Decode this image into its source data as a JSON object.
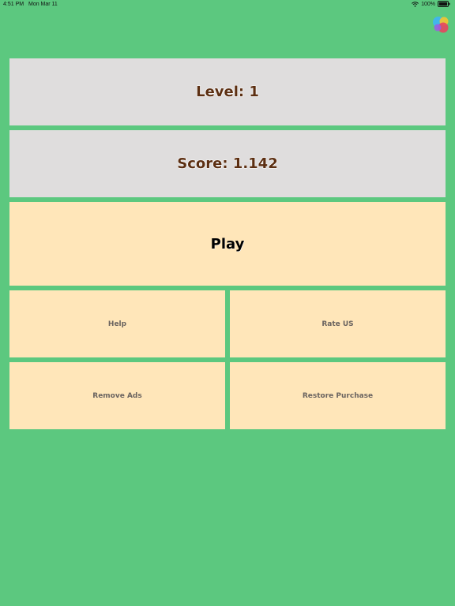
{
  "status_bar": {
    "time": "4:51 PM",
    "date": "Mon Mar 11",
    "battery": "100%"
  },
  "icons": {
    "game_center": "game-center-icon",
    "wifi": "wifi-icon",
    "battery": "battery-icon"
  },
  "level_panel": {
    "label": "Level: 1"
  },
  "score_panel": {
    "label": "Score: 1.142"
  },
  "buttons": {
    "play": "Play",
    "help": "Help",
    "rate": "Rate US",
    "remove_ads": "Remove Ads",
    "restore_purchase": "Restore Purchase"
  },
  "colors": {
    "background": "#5cc87f",
    "info_panel": "#dfdddd",
    "button_panel": "#ffe6b9",
    "info_text": "#5c2f12"
  }
}
